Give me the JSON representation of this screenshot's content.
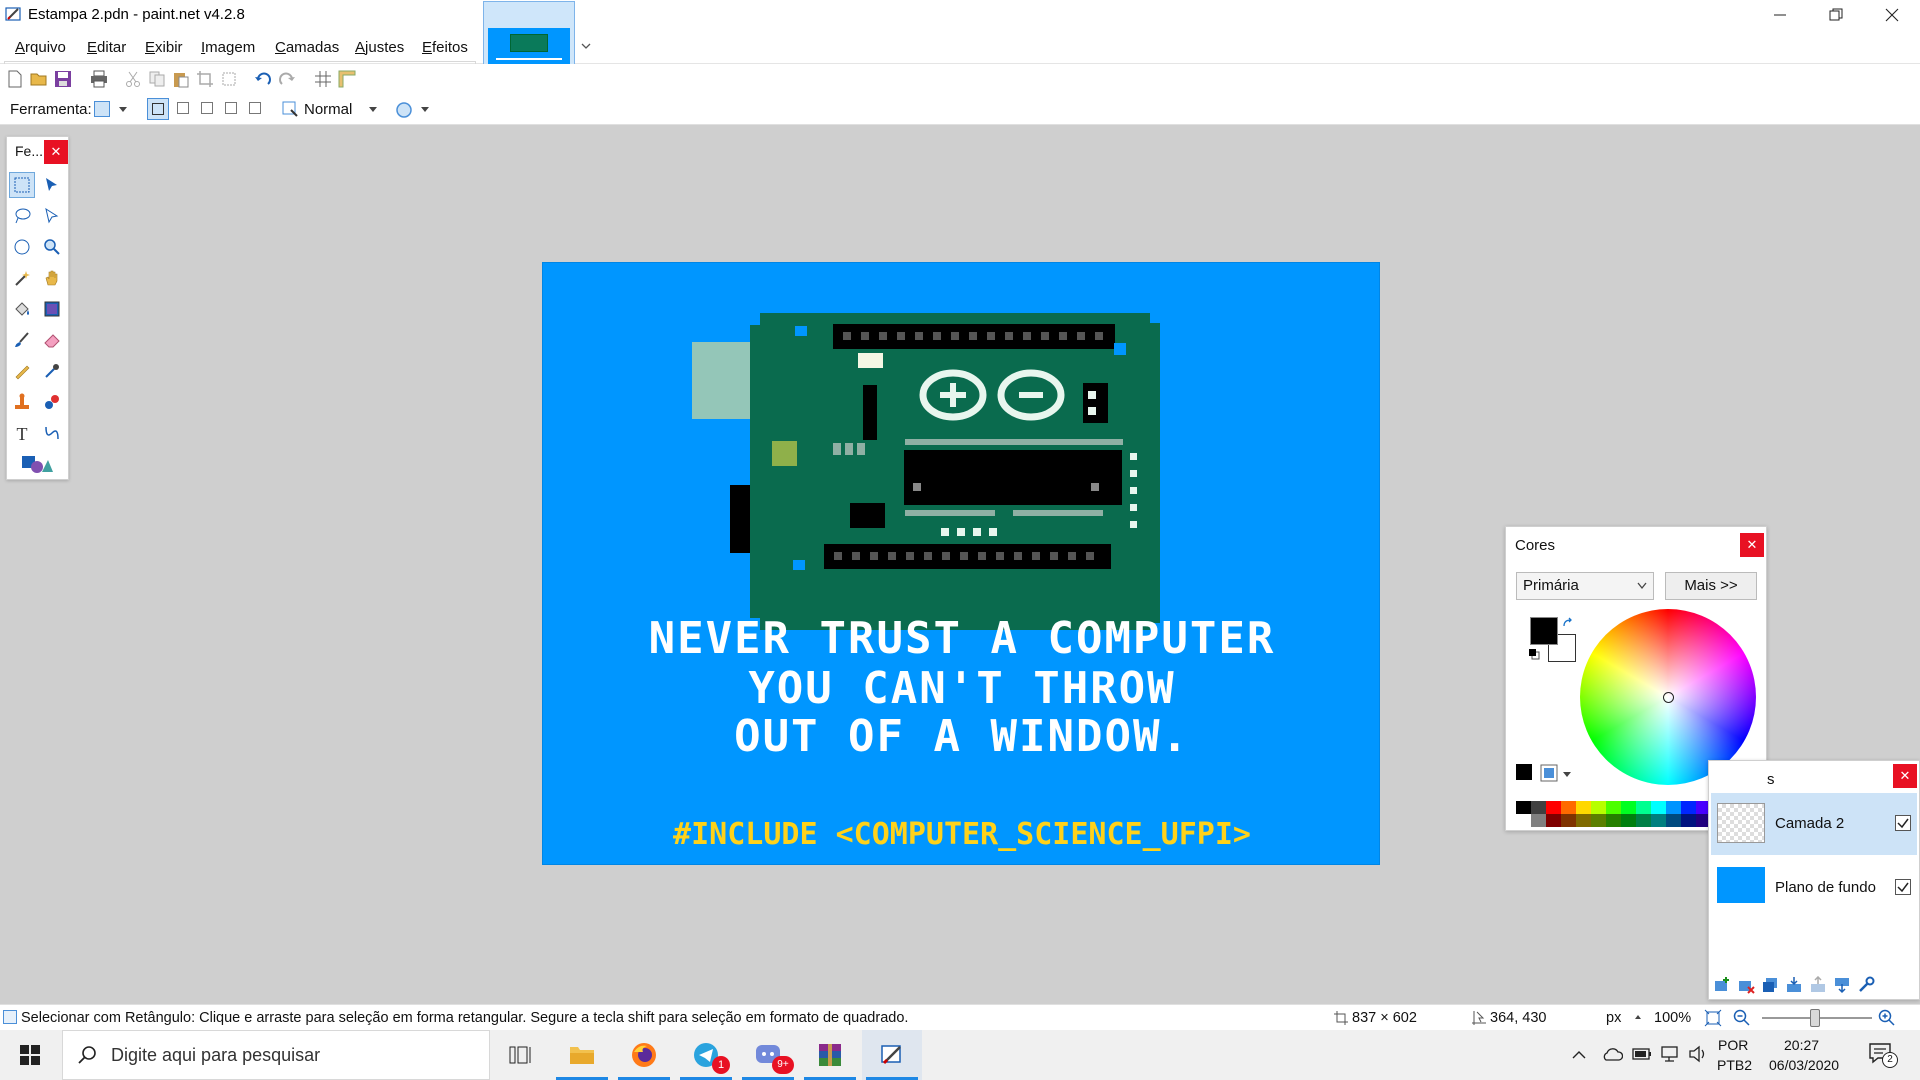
{
  "window": {
    "title": "Estampa 2.pdn - paint.net v4.2.8"
  },
  "menu": [
    {
      "label": "Arquivo"
    },
    {
      "label": "Editar"
    },
    {
      "label": "Exibir"
    },
    {
      "label": "Imagem"
    },
    {
      "label": "Camadas"
    },
    {
      "label": "Ajustes"
    },
    {
      "label": "Efeitos"
    }
  ],
  "toolbar2": {
    "tool_label": "Ferramenta:",
    "blend_mode": "Normal"
  },
  "artwork": {
    "line1": "NEVER TRUST A COMPUTER",
    "line2": "YOU CAN'T THROW",
    "line3": "OUT OF A WINDOW.",
    "include": "#INCLUDE <COMPUTER_SCIENCE_UFPI>",
    "background": "#0096ff",
    "text_color": "#ffffff",
    "include_color": "#ffd21a"
  },
  "tools_panel": {
    "title": "Fe..."
  },
  "colors_panel": {
    "title": "Cores",
    "mode": "Primária",
    "more_button": "Mais >>",
    "primary": "#000000",
    "secondary": "#ffffff"
  },
  "layers_panel": {
    "title_fragment": "s",
    "layers": [
      {
        "name": "Camada 2",
        "visible": true,
        "selected": true
      },
      {
        "name": "Plano de fundo",
        "visible": true,
        "selected": false
      }
    ]
  },
  "statusbar": {
    "hint": "Selecionar com Retângulo: Clique e arraste para seleção em forma retangular. Segure a tecla shift para seleção em formato de quadrado.",
    "image_size": "837 × 602",
    "cursor_pos": "364, 430",
    "units": "px",
    "zoom": "100%"
  },
  "taskbar": {
    "search_placeholder": "Digite aqui para pesquisar",
    "telegram_badge": "1",
    "discord_badge": "9+",
    "lang1": "POR",
    "lang2": "PTB2",
    "time": "20:27",
    "date": "06/03/2020",
    "notifications": "2"
  }
}
